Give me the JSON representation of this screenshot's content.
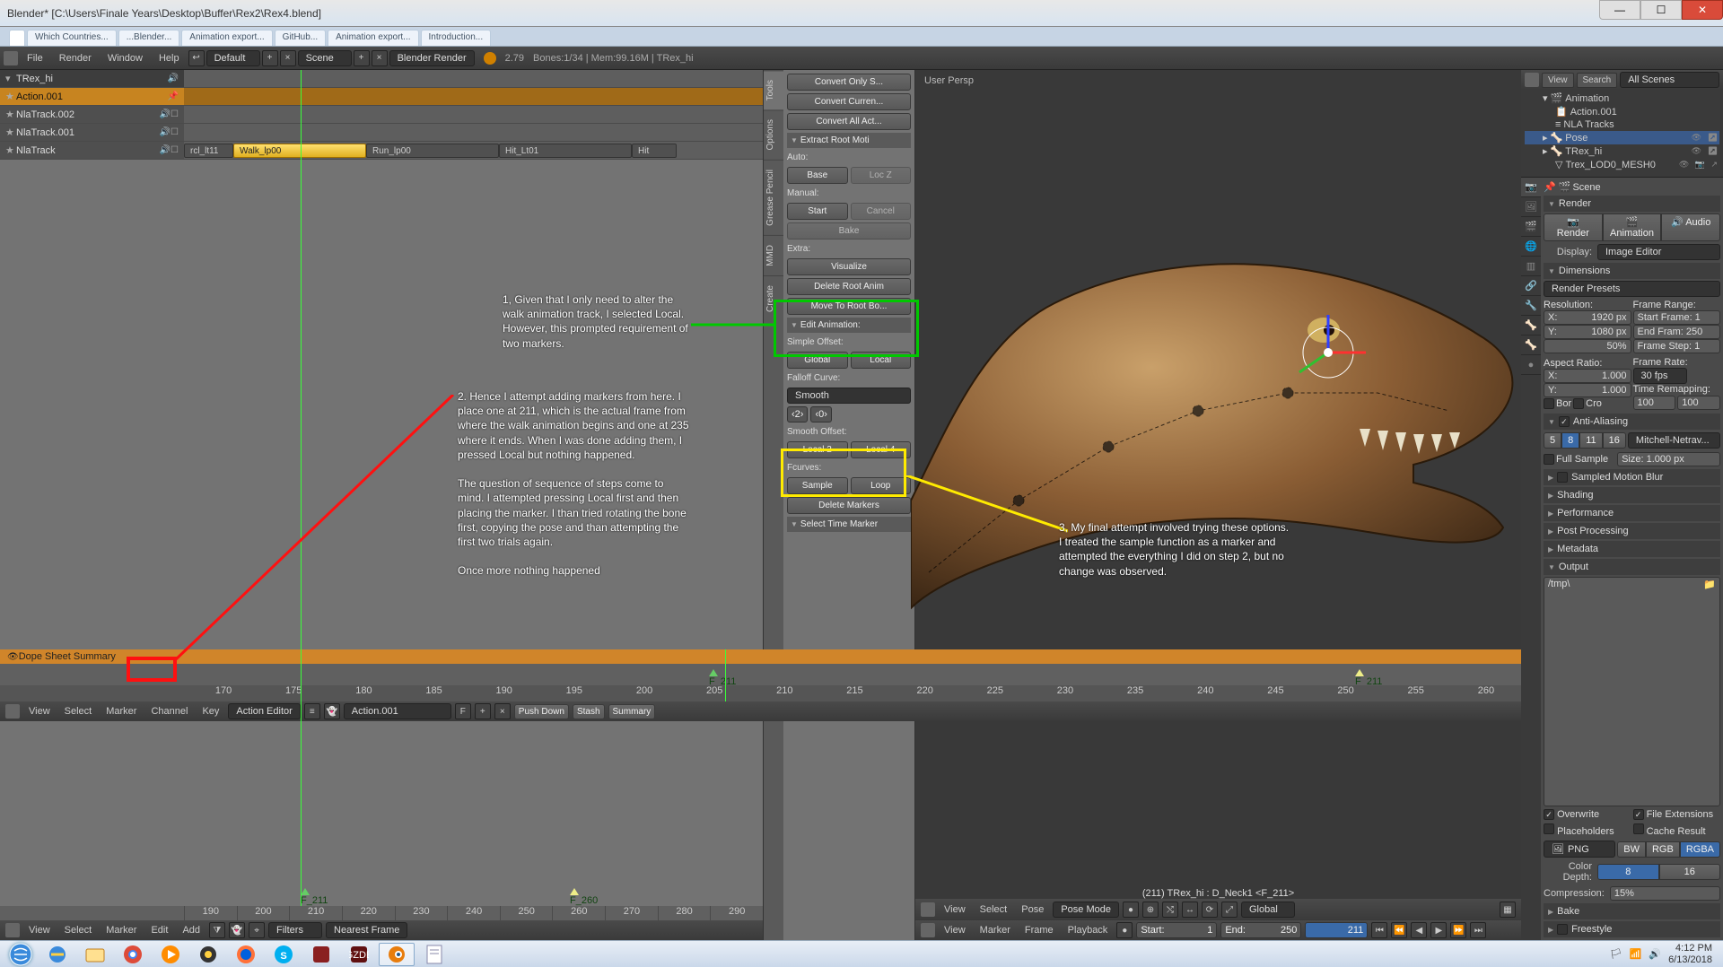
{
  "window": {
    "title": "Blender* [C:\\Users\\Finale Years\\Desktop\\Buffer\\Rex2\\Rex4.blend]"
  },
  "browser_tabs": [
    "",
    "Which Countries...",
    "...Blender...",
    "Animation export...",
    "GitHub...",
    "Animation export...",
    "Introduction..."
  ],
  "infobar": {
    "menus": [
      "File",
      "Render",
      "Window",
      "Help"
    ],
    "layout": "Default",
    "scene": "Scene",
    "engine": "Blender Render",
    "version": "2.79",
    "stats": "Bones:1/34  | Mem:99.16M | TRex_hi"
  },
  "nla": {
    "object": "TRex_hi",
    "action": "Action.001",
    "tracks": [
      "NlaTrack.002",
      "NlaTrack.001",
      "NlaTrack"
    ],
    "strips": [
      {
        "name": "rcl_lt11",
        "type": "other"
      },
      {
        "name": "Walk_lp00",
        "type": "walk"
      },
      {
        "name": "Run_lp00",
        "type": "other"
      },
      {
        "name": "Hit_Lt01",
        "type": "other"
      },
      {
        "name": "Hit",
        "type": "other"
      }
    ],
    "menus": [
      "View",
      "Select",
      "Marker",
      "Edit",
      "Add"
    ],
    "filters": "Filters",
    "nearest": "Nearest Frame",
    "ruler_ticks": [
      "190",
      "200",
      "210",
      "220",
      "230",
      "240",
      "250",
      "260",
      "270",
      "280",
      "290"
    ],
    "marker_label": "F_211",
    "marker_label2": "F_260",
    "dopesheet_label": "Dope Sheet Summary"
  },
  "tools": {
    "tabs": [
      "Tools",
      "Options",
      "Grease Pencil",
      "MMD",
      "Create"
    ],
    "convert": [
      "Convert Only S...",
      "Convert Curren...",
      "Convert All Act..."
    ],
    "extract_hdr": "Extract Root Moti",
    "auto": "Auto:",
    "base": "Base",
    "locz": "Loc Z",
    "manual": "Manual:",
    "start": "Start",
    "cancel": "Cancel",
    "bake": "Bake",
    "extra": "Extra:",
    "visualize": "Visualize",
    "del_root": "Delete Root Anim",
    "move_root": "Move To Root Bo...",
    "edit_hdr": "Edit Animation:",
    "simple_offset": "Simple Offset:",
    "global": "Global",
    "local": "Local",
    "falloff": "Falloff Curve:",
    "smooth": "Smooth",
    "seg_a": "2",
    "seg_b": "0",
    "smooth_offset": "Smooth Offset:",
    "local2": "Local 2",
    "local4": "Local 4",
    "fcurves": "Fcurves:",
    "sample": "Sample",
    "loop": "Loop",
    "del_markers": "Delete Markers",
    "select_time": "Select Time Marker"
  },
  "viewport": {
    "label": "User Persp",
    "footer": "(211) TRex_hi : D_Neck1 <F_211>",
    "header_menus": [
      "View",
      "Select",
      "Pose"
    ],
    "mode": "Pose Mode",
    "orient": "Global"
  },
  "outliner": {
    "menus": [
      "View",
      "Search"
    ],
    "all": "All Scenes",
    "items": [
      {
        "t": "Animation",
        "d": 1
      },
      {
        "t": "Action.001",
        "d": 2
      },
      {
        "t": "NLA Tracks",
        "d": 2
      },
      {
        "t": "Pose",
        "d": 1,
        "sel": true
      },
      {
        "t": "TRex_hi",
        "d": 1
      },
      {
        "t": "Trex_LOD0_MESH0",
        "d": 2
      }
    ]
  },
  "props": {
    "scene": "Scene",
    "render_hdr": "Render",
    "render_btns": [
      "Render",
      "Animation",
      "Audio"
    ],
    "display": "Display:",
    "image_editor": "Image Editor",
    "dim_hdr": "Dimensions",
    "presets": "Render Presets",
    "res": "Resolution:",
    "x": "X:",
    "x_v": "1920 px",
    "y": "Y:",
    "y_v": "1080 px",
    "pct": "50%",
    "fr": "Frame Range:",
    "sf": "Start Frame: 1",
    "ef": "End Fram: 250",
    "fs": "Frame Step:  1",
    "ar": "Aspect Ratio:",
    "ax": "1.000",
    "ay": "1.000",
    "frl": "Frame Rate:",
    "fps": "30 fps",
    "bor": "Bor",
    "cro": "Cro",
    "tr": "Time Remapping:",
    "old": "100",
    "new": "100",
    "aa_hdr": "Anti-Aliasing",
    "aa_opts": [
      "5",
      "8",
      "11",
      "16"
    ],
    "aa_filter": "Mitchell-Netrav...",
    "full": "Full Sample",
    "size": "Size: 1.000 px",
    "smb": "Sampled Motion Blur",
    "shading": "Shading",
    "perf": "Performance",
    "post": "Post Processing",
    "meta": "Metadata",
    "out_hdr": "Output",
    "path": "/tmp\\",
    "ow": "Overwrite",
    "fe": "File Extensions",
    "ph": "Placeholders",
    "cr": "Cache Result",
    "fmt": "PNG",
    "bw": "BW",
    "rgb": "RGB",
    "rgba": "RGBA",
    "cd": "Color Depth:",
    "d8": "8",
    "d16": "16",
    "comp": "Compression:",
    "comp_v": "15%",
    "bake": "Bake",
    "free": "Freestyle"
  },
  "timeline": {
    "menus": [
      "View",
      "Marker",
      "Frame",
      "Playback"
    ],
    "start_l": "Start:",
    "start_v": "1",
    "end_l": "End:",
    "end_v": "250",
    "cur": "211"
  },
  "dope": {
    "menus": [
      "View",
      "Select",
      "Marker",
      "Channel",
      "Key"
    ],
    "mode": "Action Editor",
    "action": "Action.001",
    "push": "Push Down",
    "stash": "Stash",
    "summary": "Summary"
  },
  "annotations": {
    "a1": "1, Given that I only need to alter the walk animation track, I selected Local. However, this prompted requirement of two markers.",
    "a2": "2. Hence I attempt adding markers from here. I place one at 211, which is the actual frame from where the walk animation begins and one at 235 where it ends.  When I was done adding them, I pressed Local but nothing happened.\n\nThe question of sequence of steps come to mind. I attempted pressing Local first and then placing the marker. I than tried rotating the bone first, copying the pose and than attempting the first two trials again.\n\nOnce more nothing happened",
    "a3": "3, My final attempt involved trying these options. I treated the sample function as a marker and attempted the everything I did on step 2, but no change was observed."
  },
  "tray": {
    "time": "4:12 PM",
    "date": "6/13/2018"
  }
}
